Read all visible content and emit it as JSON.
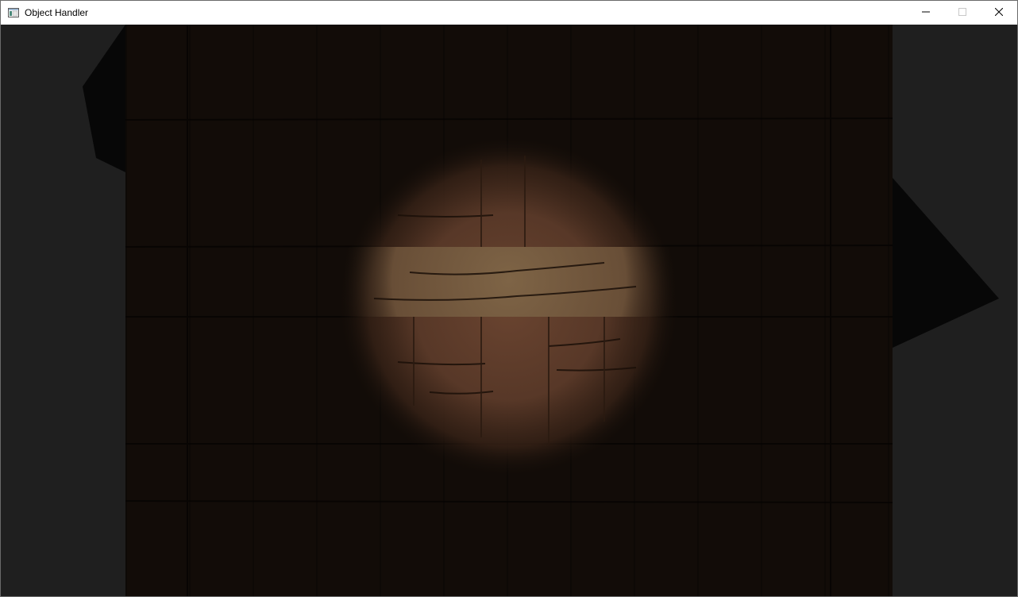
{
  "window": {
    "title": "Object Handler",
    "icon": "app-window-icon",
    "controls": {
      "minimize_icon": "minimize-icon",
      "maximize_icon": "maximize-icon",
      "close_icon": "close-icon"
    }
  },
  "scene": {
    "background_color": "#1f1f1f",
    "wood_color_dark": "#120c08",
    "wood_color_lit": "#5a3a28",
    "plank_lit": "#6b5238",
    "light": "spotlight"
  }
}
